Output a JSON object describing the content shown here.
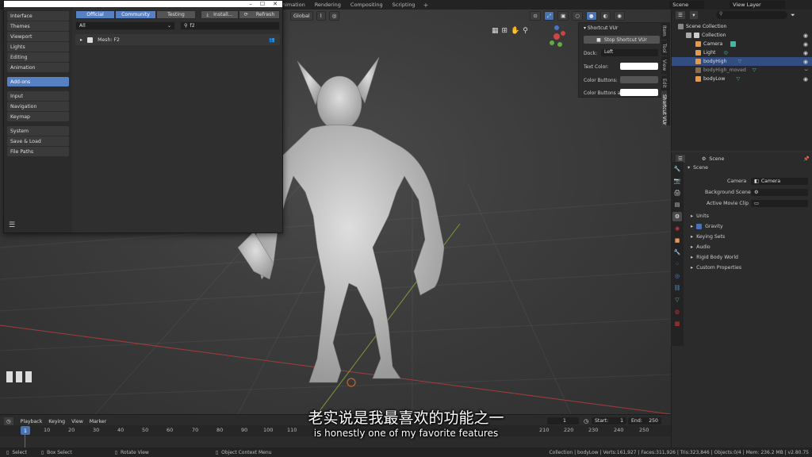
{
  "topbar": {
    "workspaces": [
      "nimation",
      "Rendering",
      "Compositing",
      "Scripting"
    ],
    "add_label": "+",
    "scene_label": "Scene",
    "view_layer_label": "View Layer"
  },
  "viewport_header": {
    "orientation": "Global"
  },
  "prefs": {
    "categories_a": [
      "Interface",
      "Themes",
      "Viewport",
      "Lights",
      "Editing",
      "Animation"
    ],
    "active_category": "Add-ons",
    "categories_b": [
      "Input",
      "Navigation",
      "Keymap"
    ],
    "categories_c": [
      "System",
      "Save & Load",
      "File Paths"
    ],
    "support_tabs": [
      "Official",
      "Community",
      "Testing"
    ],
    "install_label": "Install...",
    "refresh_label": "Refresh",
    "category_filter": "All",
    "search_value": "f2",
    "addon_name": "Mesh: F2"
  },
  "npanel": {
    "panel_title": "Shortcut VUr",
    "stop_button": "Stop Shortcut VUr",
    "dock_label": "Dock:",
    "dock_value": "Left",
    "text_color_label": "Text Color:",
    "color_buttons_label": "Color Buttons:",
    "color_buttons_a_label": "Color Buttons a...",
    "tabs": [
      "Item",
      "Tool",
      "View",
      "Edit",
      "Shortcut VUr"
    ]
  },
  "outliner": {
    "rows": [
      {
        "label": "Scene Collection",
        "color": "#aaaaaa"
      },
      {
        "label": "Collection",
        "color": "#cccccc"
      },
      {
        "label": "Camera",
        "color": "#e39a4c"
      },
      {
        "label": "Light",
        "color": "#e39a4c"
      },
      {
        "label": "bodyHigh",
        "color": "#e39a4c"
      },
      {
        "label": "bodyHigh_moved",
        "color": "#e39a4c"
      },
      {
        "label": "bodyLow",
        "color": "#e39a4c"
      }
    ]
  },
  "props": {
    "header": "Scene",
    "section": "Scene",
    "camera_label": "Camera",
    "camera_value": "Camera",
    "bg_scene_label": "Background Scene",
    "movie_clip_label": "Active Movie Clip",
    "panels": [
      "Units",
      "Gravity",
      "Keying Sets",
      "Audio",
      "Rigid Body World",
      "Custom Properties"
    ]
  },
  "timeline": {
    "menus": [
      "Playback",
      "Keying",
      "View",
      "Marker"
    ],
    "current_frame": "1",
    "start_label": "Start:",
    "start_value": "1",
    "end_label": "End:",
    "end_value": "250",
    "ticks": [
      "1",
      "10",
      "20",
      "30",
      "40",
      "50",
      "60",
      "70",
      "80",
      "90",
      "100",
      "110",
      "210",
      "220",
      "230",
      "240",
      "250"
    ]
  },
  "statusbar": {
    "select": "Select",
    "box_select": "Box Select",
    "rotate_view": "Rotate View",
    "context_menu": "Object Context Menu",
    "stats": "Collection | bodyLow | Verts:161,927 | Faces:311,926 | Tris:323,846 | Objects:0/4 | Mem: 236.2 MB | v2.80.75"
  },
  "subtitle": {
    "zh": "老实说是我最喜欢的功能之一",
    "en": "is honestly one of my favorite features"
  },
  "colors": {
    "accent": "#5680c2",
    "selected": "#334d80",
    "object_orange": "#e39a4c"
  }
}
